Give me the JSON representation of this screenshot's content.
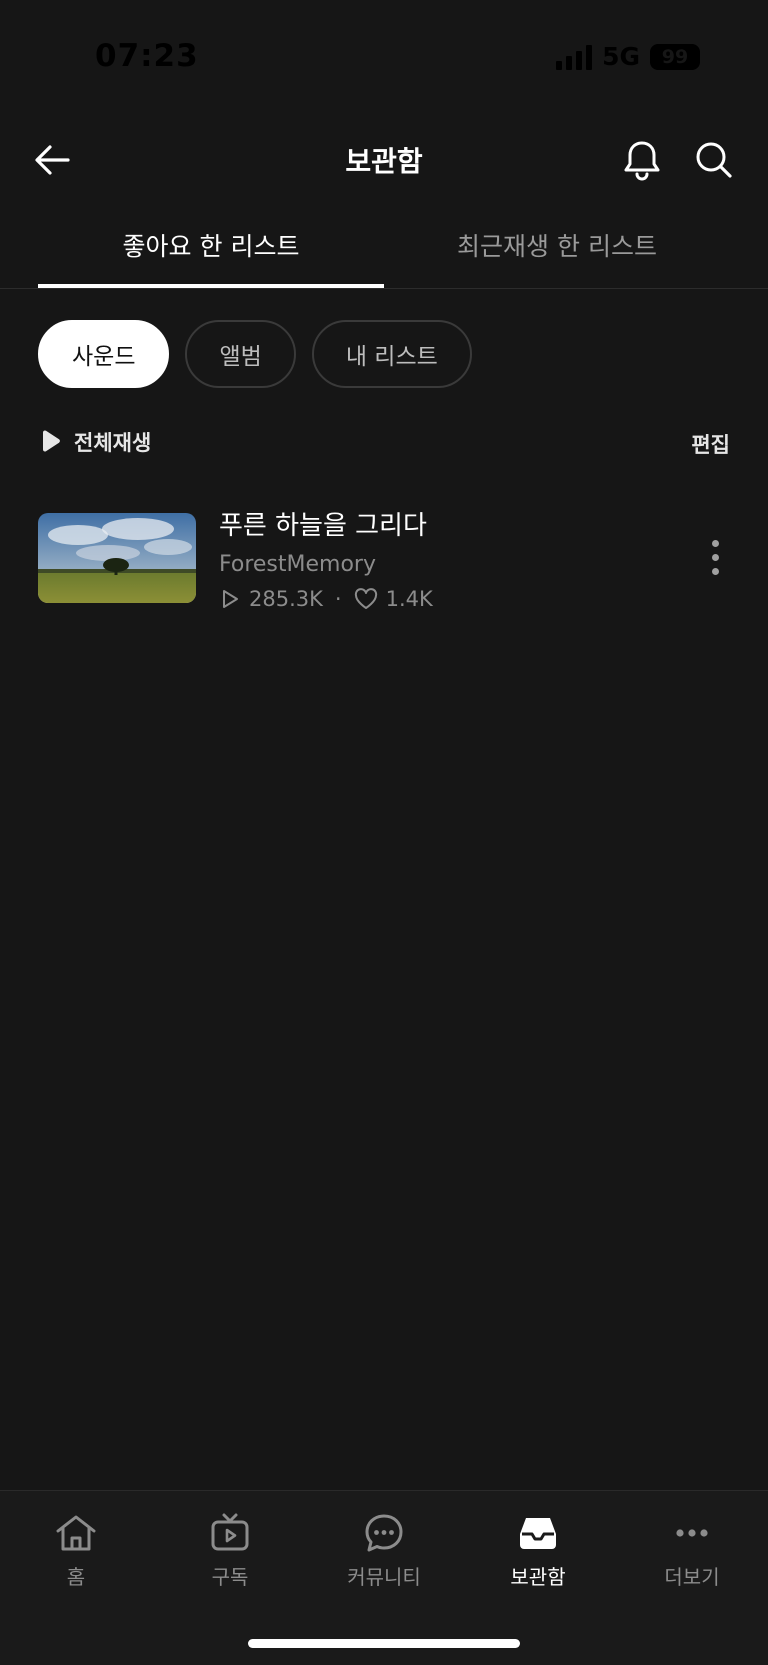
{
  "status_bar": {
    "time": "07:23",
    "network": "5G",
    "battery": "99"
  },
  "header": {
    "title": "보관함"
  },
  "tabs": [
    {
      "label": "좋아요 한 리스트",
      "active": true
    },
    {
      "label": "최근재생 한 리스트",
      "active": false
    }
  ],
  "chips": [
    {
      "label": "사운드",
      "active": true
    },
    {
      "label": "앨범",
      "active": false
    },
    {
      "label": "내 리스트",
      "active": false
    }
  ],
  "actions": {
    "play_all": "전체재생",
    "edit": "편집"
  },
  "items": [
    {
      "title": "푸른 하늘을 그리다",
      "artist": "ForestMemory",
      "plays": "285.3K",
      "likes": "1.4K"
    }
  ],
  "bottom_nav": [
    {
      "label": "홈",
      "icon": "home-icon",
      "active": false
    },
    {
      "label": "구독",
      "icon": "tv-icon",
      "active": false
    },
    {
      "label": "커뮤니티",
      "icon": "chat-bubble-icon",
      "active": false
    },
    {
      "label": "보관함",
      "icon": "inbox-icon",
      "active": true
    },
    {
      "label": "더보기",
      "icon": "more-dots-icon",
      "active": false
    }
  ]
}
